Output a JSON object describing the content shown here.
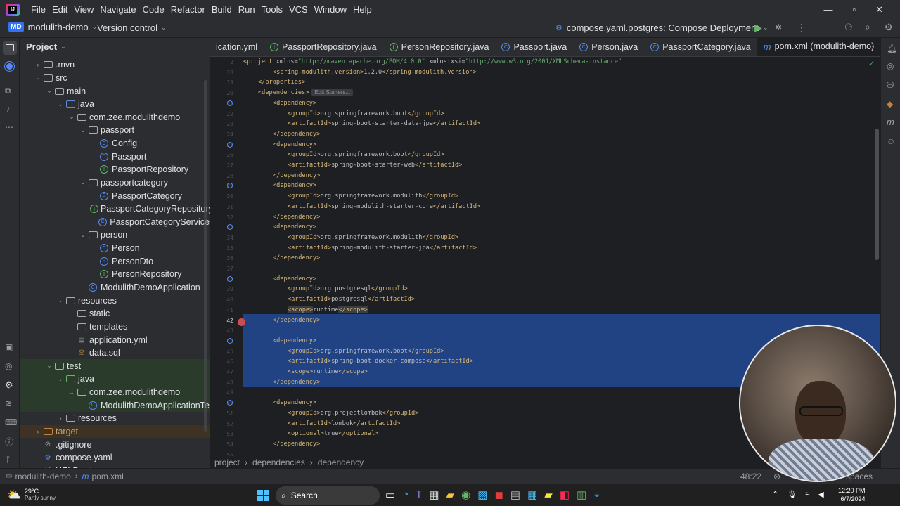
{
  "menu": {
    "items": [
      "File",
      "Edit",
      "View",
      "Navigate",
      "Code",
      "Refactor",
      "Build",
      "Run",
      "Tools",
      "VCS",
      "Window",
      "Help"
    ]
  },
  "toolbar": {
    "project_badge": "MD",
    "project_name": "modulith-demo",
    "vcs": "Version control",
    "run_config": "compose.yaml.postgres: Compose Deployment"
  },
  "project_panel": {
    "title": "Project"
  },
  "tree": [
    {
      "label": ".mvn",
      "indent": 1,
      "arrow": "›",
      "icon": "folder"
    },
    {
      "label": "src",
      "indent": 1,
      "arrow": "⌄",
      "icon": "folder"
    },
    {
      "label": "main",
      "indent": 2,
      "arrow": "⌄",
      "icon": "folder"
    },
    {
      "label": "java",
      "indent": 3,
      "arrow": "⌄",
      "icon": "folder-blue"
    },
    {
      "label": "com.zee.modulithdemo",
      "indent": 4,
      "arrow": "⌄",
      "icon": "package"
    },
    {
      "label": "passport",
      "indent": 5,
      "arrow": "⌄",
      "icon": "package"
    },
    {
      "label": "Config",
      "indent": 6,
      "arrow": "",
      "icon": "class"
    },
    {
      "label": "Passport",
      "indent": 6,
      "arrow": "",
      "icon": "class"
    },
    {
      "label": "PassportRepository",
      "indent": 6,
      "arrow": "",
      "icon": "interface"
    },
    {
      "label": "passportcategory",
      "indent": 5,
      "arrow": "⌄",
      "icon": "package"
    },
    {
      "label": "PassportCategory",
      "indent": 6,
      "arrow": "",
      "icon": "class"
    },
    {
      "label": "PassportCategoryRepository",
      "indent": 6,
      "arrow": "",
      "icon": "interface"
    },
    {
      "label": "PassportCategoryService",
      "indent": 6,
      "arrow": "",
      "icon": "class"
    },
    {
      "label": "person",
      "indent": 5,
      "arrow": "⌄",
      "icon": "package"
    },
    {
      "label": "Person",
      "indent": 6,
      "arrow": "",
      "icon": "class"
    },
    {
      "label": "PersonDto",
      "indent": 6,
      "arrow": "",
      "icon": "record"
    },
    {
      "label": "PersonRepository",
      "indent": 6,
      "arrow": "",
      "icon": "interface"
    },
    {
      "label": "ModulithDemoApplication",
      "indent": 5,
      "arrow": "",
      "icon": "class"
    },
    {
      "label": "resources",
      "indent": 3,
      "arrow": "⌄",
      "icon": "folder"
    },
    {
      "label": "static",
      "indent": 4,
      "arrow": "",
      "icon": "folder"
    },
    {
      "label": "templates",
      "indent": 4,
      "arrow": "",
      "icon": "folder"
    },
    {
      "label": "application.yml",
      "indent": 4,
      "arrow": "",
      "icon": "yaml"
    },
    {
      "label": "data.sql",
      "indent": 4,
      "arrow": "",
      "icon": "sql"
    },
    {
      "label": "test",
      "indent": 2,
      "arrow": "⌄",
      "icon": "folder"
    },
    {
      "label": "java",
      "indent": 3,
      "arrow": "⌄",
      "icon": "folder-green"
    },
    {
      "label": "com.zee.modulithdemo",
      "indent": 4,
      "arrow": "⌄",
      "icon": "package"
    },
    {
      "label": "ModulithDemoApplicationTe",
      "indent": 5,
      "arrow": "",
      "icon": "class"
    },
    {
      "label": "resources",
      "indent": 3,
      "arrow": "›",
      "icon": "folder"
    },
    {
      "label": "target",
      "indent": 1,
      "arrow": "›",
      "icon": "folder-orange"
    },
    {
      "label": ".gitignore",
      "indent": 1,
      "arrow": "",
      "icon": "gitignore"
    },
    {
      "label": "compose.yaml",
      "indent": 1,
      "arrow": "",
      "icon": "compose"
    },
    {
      "label": "HELP.md",
      "indent": 1,
      "arrow": "",
      "icon": "md"
    }
  ],
  "tabs": [
    {
      "label": "ication.yml",
      "icon": ""
    },
    {
      "label": "PassportRepository.java",
      "icon": "interface"
    },
    {
      "label": "PersonRepository.java",
      "icon": "interface"
    },
    {
      "label": "Passport.java",
      "icon": "class"
    },
    {
      "label": "Person.java",
      "icon": "class"
    },
    {
      "label": "PassportCategory.java",
      "icon": "class"
    },
    {
      "label": "pom.xml (modulith-demo)",
      "icon": "maven",
      "active": true
    }
  ],
  "code_lines": [
    {
      "n": "2",
      "html": "<span class='tag'>&lt;project </span><span class='attr'>xmlns=</span><span class='str'>\"http://maven.apache.org/POM/4.0.0\"</span> <span class='attr'>xmlns:xsi=</span><span class='str'>\"http://www.w3.org/2001/XMLSchema-instance\"</span>",
      "indent": 0
    },
    {
      "n": "18",
      "html": "<span class='tag'>&lt;spring-modulith.version&gt;</span><span class='txt'>1.2.0</span><span class='tag'>&lt;/spring-modulith.version&gt;</span>",
      "indent": 2
    },
    {
      "n": "19",
      "html": "<span class='tag'>&lt;/properties&gt;</span>",
      "indent": 1
    },
    {
      "n": "20",
      "html": "<span class='tag'>&lt;dependencies&gt;</span>",
      "indent": 1,
      "hint": "Edit Starters..."
    },
    {
      "n": "21",
      "html": "<span class='tag'>&lt;dependency&gt;</span>",
      "indent": 2
    },
    {
      "n": "22",
      "html": "<span class='tag'>&lt;groupId&gt;</span><span class='txt'>org.springframework.boot</span><span class='tag'>&lt;/groupId&gt;</span>",
      "indent": 3
    },
    {
      "n": "23",
      "html": "<span class='tag'>&lt;artifactId&gt;</span><span class='txt'>spring-boot-starter-data-jpa</span><span class='tag'>&lt;/artifactId&gt;</span>",
      "indent": 3
    },
    {
      "n": "24",
      "html": "<span class='tag'>&lt;/dependency&gt;</span>",
      "indent": 2
    },
    {
      "n": "25",
      "html": "<span class='tag'>&lt;dependency&gt;</span>",
      "indent": 2
    },
    {
      "n": "26",
      "html": "<span class='tag'>&lt;groupId&gt;</span><span class='txt'>org.springframework.boot</span><span class='tag'>&lt;/groupId&gt;</span>",
      "indent": 3
    },
    {
      "n": "27",
      "html": "<span class='tag'>&lt;artifactId&gt;</span><span class='txt'>spring-boot-starter-web</span><span class='tag'>&lt;/artifactId&gt;</span>",
      "indent": 3
    },
    {
      "n": "28",
      "html": "<span class='tag'>&lt;/dependency&gt;</span>",
      "indent": 2
    },
    {
      "n": "29",
      "html": "<span class='tag'>&lt;dependency&gt;</span>",
      "indent": 2
    },
    {
      "n": "30",
      "html": "<span class='tag'>&lt;groupId&gt;</span><span class='txt'>org.springframework.modulith</span><span class='tag'>&lt;/groupId&gt;</span>",
      "indent": 3
    },
    {
      "n": "31",
      "html": "<span class='tag'>&lt;artifactId&gt;</span><span class='txt'>spring-modulith-starter-core</span><span class='tag'>&lt;/artifactId&gt;</span>",
      "indent": 3
    },
    {
      "n": "32",
      "html": "<span class='tag'>&lt;/dependency&gt;</span>",
      "indent": 2
    },
    {
      "n": "33",
      "html": "<span class='tag'>&lt;dependency&gt;</span>",
      "indent": 2
    },
    {
      "n": "34",
      "html": "<span class='tag'>&lt;groupId&gt;</span><span class='txt'>org.springframework.modulith</span><span class='tag'>&lt;/groupId&gt;</span>",
      "indent": 3
    },
    {
      "n": "35",
      "html": "<span class='tag'>&lt;artifactId&gt;</span><span class='txt'>spring-modulith-starter-jpa</span><span class='tag'>&lt;/artifactId&gt;</span>",
      "indent": 3
    },
    {
      "n": "36",
      "html": "<span class='tag'>&lt;/dependency&gt;</span>",
      "indent": 2
    },
    {
      "n": "37",
      "html": "",
      "indent": 0
    },
    {
      "n": "38",
      "html": "<span class='tag'>&lt;dependency&gt;</span>",
      "indent": 2
    },
    {
      "n": "39",
      "html": "<span class='tag'>&lt;groupId&gt;</span><span class='txt'>org.postgresql</span><span class='tag'>&lt;/groupId&gt;</span>",
      "indent": 3
    },
    {
      "n": "40",
      "html": "<span class='tag'>&lt;artifactId&gt;</span><span class='txt'>postgresql</span><span class='tag'>&lt;/artifactId&gt;</span>",
      "indent": 3
    },
    {
      "n": "41",
      "html": "<span class='tag' style='background:#3b3d41'>&lt;scope&gt;</span><span class='txt'>runtime</span><span class='tag' style='background:#3b3d41'>&lt;/scope&gt;</span>",
      "indent": 3
    },
    {
      "n": "42",
      "html": "<span class='tag'>&lt;/dependency&gt;</span>",
      "indent": 2
    },
    {
      "n": "43",
      "html": "",
      "indent": 0
    },
    {
      "n": "44",
      "html": "<span class='tag'>&lt;dependency&gt;</span>",
      "indent": 2
    },
    {
      "n": "45",
      "html": "<span class='tag'>&lt;groupId&gt;</span><span class='txt'>org.springframework.boot</span><span class='tag'>&lt;/groupId&gt;</span>",
      "indent": 3
    },
    {
      "n": "46",
      "html": "<span class='tag'>&lt;artifactId&gt;</span><span class='txt'>spring-boot-docker-compose</span><span class='tag'>&lt;/artifactId&gt;</span>",
      "indent": 3
    },
    {
      "n": "47",
      "html": "<span class='tag'>&lt;scope&gt;</span><span class='txt'>runtime</span><span class='tag'>&lt;/scope&gt;</span>",
      "indent": 3
    },
    {
      "n": "48",
      "html": "<span class='tag'>&lt;/dependency&gt;</span>",
      "indent": 2
    },
    {
      "n": "49",
      "html": "",
      "indent": 0
    },
    {
      "n": "50",
      "html": "<span class='tag'>&lt;dependency&gt;</span>",
      "indent": 2
    },
    {
      "n": "51",
      "html": "<span class='tag'>&lt;groupId&gt;</span><span class='txt'>org.projectlombok</span><span class='tag'>&lt;/groupId&gt;</span>",
      "indent": 3
    },
    {
      "n": "52",
      "html": "<span class='tag'>&lt;artifactId&gt;</span><span class='txt'>lombok</span><span class='tag'>&lt;/artifactId&gt;</span>",
      "indent": 3
    },
    {
      "n": "53",
      "html": "<span class='tag'>&lt;optional&gt;</span><span class='txt'>true</span><span class='tag'>&lt;/optional&gt;</span>",
      "indent": 3
    },
    {
      "n": "54",
      "html": "<span class='tag'>&lt;/dependency&gt;</span>",
      "indent": 2
    },
    {
      "n": "55",
      "html": "",
      "indent": 0
    }
  ],
  "breadcrumbs": [
    "project",
    "dependencies",
    "dependency"
  ],
  "status": {
    "project": "modulith-demo",
    "file": "pom.xml",
    "position": "48:22",
    "indent": "spaces"
  },
  "taskbar": {
    "temp": "29°C",
    "weather": "Partly sunny",
    "search": "Search",
    "time": "12:20 PM",
    "date": "6/7/2024"
  },
  "colors": {
    "accent": "#3574f0",
    "selection": "#214283",
    "panel": "#2b2d30",
    "editor": "#1e1f22"
  }
}
